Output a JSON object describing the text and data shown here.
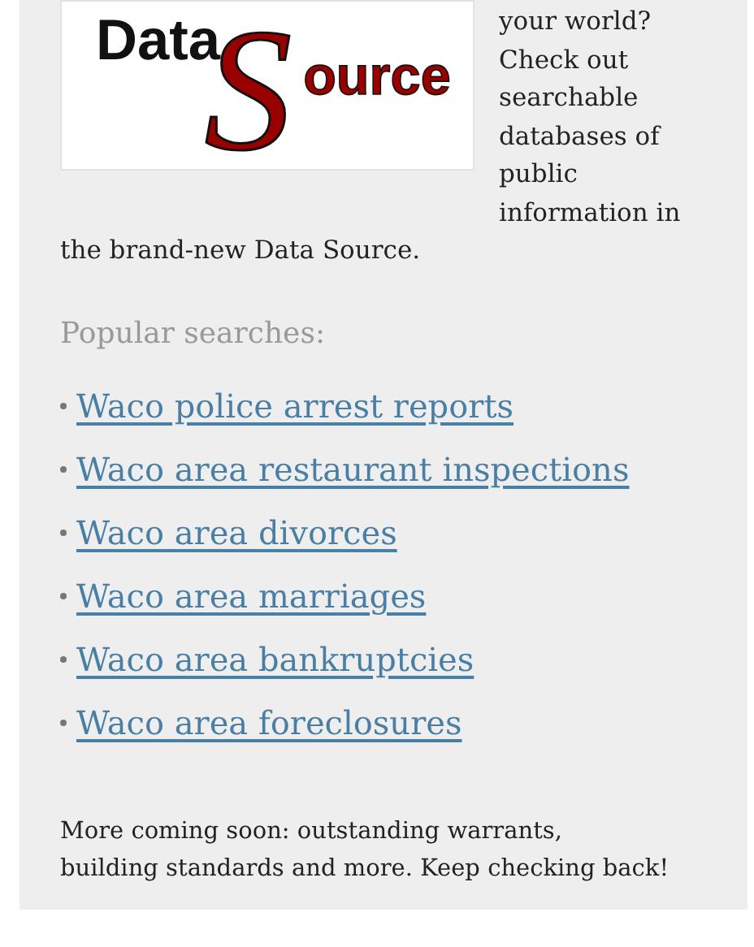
{
  "logo": {
    "top_word": "Data",
    "initial": "S",
    "rest": "ource"
  },
  "intro": [
    "your world? Check out searchable databases of public information in",
    "the brand-new Data Source."
  ],
  "popular_searches": {
    "heading": "Popular searches:",
    "links": [
      {
        "label": "Waco police arrest reports"
      },
      {
        "label": "Waco area restaurant inspections"
      },
      {
        "label": "Waco area divorces"
      },
      {
        "label": "Waco area marriages"
      },
      {
        "label": "Waco area bankruptcies"
      },
      {
        "label": "Waco area foreclosures"
      }
    ]
  },
  "note": "More coming soon: outstanding warrants, building standards and more. Keep checking back!"
}
